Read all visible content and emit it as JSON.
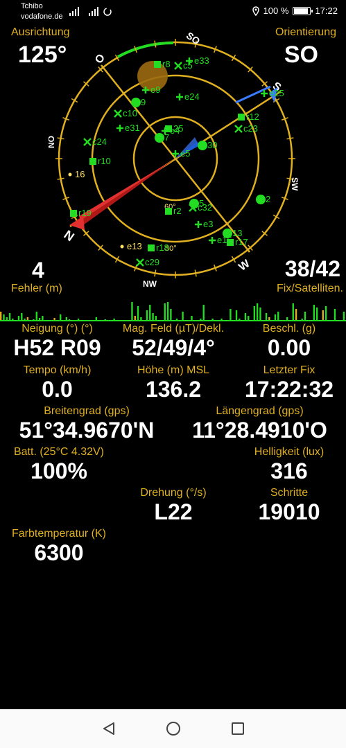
{
  "status": {
    "carrier1": "Tchibo",
    "carrier2": "vodafone.de",
    "battery_text": "100 %",
    "battery_level": 1.0,
    "time": "17:22"
  },
  "heading": {
    "label": "Ausrichtung",
    "value": "125°"
  },
  "orientation": {
    "label": "Orientierung",
    "value": "SO"
  },
  "compass": {
    "cardinals": [
      "SO",
      "S",
      "SW",
      "W",
      "NW",
      "N",
      "NO",
      "O"
    ],
    "accent_color": "#e0b020",
    "sat_color": "#22dd22",
    "inner_labels": [
      "60°",
      "30°"
    ],
    "satellites": [
      {
        "id": "r8",
        "shape": "square"
      },
      {
        "id": "c5",
        "shape": "cross"
      },
      {
        "id": "e33",
        "shape": "plus"
      },
      {
        "id": "e9",
        "shape": "plus"
      },
      {
        "id": "9",
        "shape": "circle"
      },
      {
        "id": "c10",
        "shape": "cross"
      },
      {
        "id": "e24",
        "shape": "plus"
      },
      {
        "id": "e25",
        "shape": "plus"
      },
      {
        "id": "r12",
        "shape": "square"
      },
      {
        "id": "c23",
        "shape": "cross"
      },
      {
        "id": "e31",
        "shape": "plus"
      },
      {
        "id": "c24",
        "shape": "cross"
      },
      {
        "id": "e4",
        "shape": "plus"
      },
      {
        "id": "r10",
        "shape": "square"
      },
      {
        "id": "25",
        "shape": "square"
      },
      {
        "id": "7",
        "shape": "circle"
      },
      {
        "id": "e5",
        "shape": "plus"
      },
      {
        "id": "30",
        "shape": "circle"
      },
      {
        "id": "16",
        "shape": "dot"
      },
      {
        "id": "2",
        "shape": "circle"
      },
      {
        "id": "r19",
        "shape": "square"
      },
      {
        "id": "r2",
        "shape": "square"
      },
      {
        "id": "5",
        "shape": "circle"
      },
      {
        "id": "c32",
        "shape": "cross"
      },
      {
        "id": "e3",
        "shape": "plus"
      },
      {
        "id": "13",
        "shape": "circle"
      },
      {
        "id": "e15",
        "shape": "plus"
      },
      {
        "id": "r17",
        "shape": "square"
      },
      {
        "id": "e13",
        "shape": "dot"
      },
      {
        "id": "r18",
        "shape": "square"
      },
      {
        "id": "c29",
        "shape": "cross"
      }
    ]
  },
  "fix": {
    "errors_value": "4",
    "errors_label": "Fehler (m)",
    "fix_value": "38/42",
    "fix_label": "Fix/Satelliten."
  },
  "metrics": {
    "tilt": {
      "label": "Neigung (°) (°)",
      "value": "H52 R09"
    },
    "magfield": {
      "label": "Mag. Feld (µT)/Dekl.",
      "value": "52/49/4°"
    },
    "accel": {
      "label": "Beschl. (g)",
      "value": "0.00"
    },
    "speed": {
      "label": "Tempo (km/h)",
      "value": "0.0"
    },
    "altitude": {
      "label": "Höhe (m) MSL",
      "value": "136.2"
    },
    "lastfix": {
      "label": "Letzter Fix",
      "value": "17:22:32"
    },
    "lat": {
      "label": "Breitengrad (gps)",
      "value": "51°34.9670'N"
    },
    "lon": {
      "label": "Längengrad (gps)",
      "value": "11°28.4910'O"
    },
    "battery": {
      "label": "Batt. (25°C 4.32V)",
      "value": "100%"
    },
    "brightness": {
      "label": "Helligkeit (lux)",
      "value": "316"
    },
    "rotation": {
      "label": "Drehung (°/s)",
      "value": "L22"
    },
    "steps": {
      "label": "Schritte",
      "value": "19010"
    },
    "colortemp": {
      "label": "Farbtemperatur (K)",
      "value": "6300"
    }
  },
  "navbar": {
    "back_icon": "back-triangle-icon",
    "home_icon": "home-circle-icon",
    "recents_icon": "recents-square-icon"
  }
}
